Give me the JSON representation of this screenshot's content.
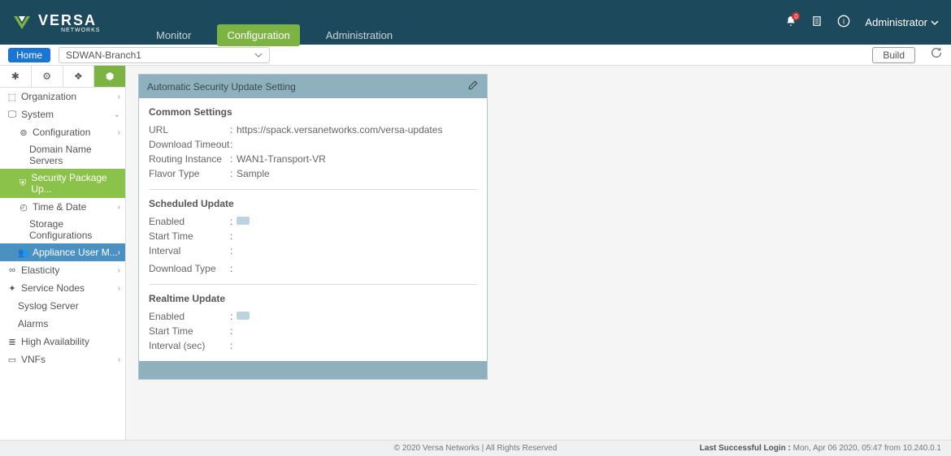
{
  "logo": {
    "text": "VERSA",
    "sub": "NETWORKS"
  },
  "topnav": {
    "monitor": "Monitor",
    "configuration": "Configuration",
    "administration": "Administration"
  },
  "header": {
    "notif_count": "0",
    "admin": "Administrator"
  },
  "subheader": {
    "home": "Home",
    "device": "SDWAN-Branch1",
    "build": "Build"
  },
  "sidebar": {
    "organization": "Organization",
    "system": "System",
    "configuration": "Configuration",
    "dns": "Domain Name Servers",
    "spack": "Security Package Up...",
    "time": "Time & Date",
    "storage": "Storage Configurations",
    "appliance": "Appliance User M...",
    "elasticity": "Elasticity",
    "servicenodes": "Service Nodes",
    "syslog": "Syslog Server",
    "alarms": "Alarms",
    "ha": "High Availability",
    "vnfs": "VNFs"
  },
  "panel": {
    "title": "Automatic Security Update Setting",
    "common": {
      "heading": "Common Settings",
      "url_label": "URL",
      "url_value": "https://spack.versanetworks.com/versa-updates",
      "dtimeout_label": "Download Timeout",
      "dtimeout_value": "",
      "routing_label": "Routing Instance",
      "routing_value": "WAN1-Transport-VR",
      "flavor_label": "Flavor Type",
      "flavor_value": "Sample"
    },
    "scheduled": {
      "heading": "Scheduled Update",
      "enabled_label": "Enabled",
      "start_label": "Start Time",
      "start_value": "",
      "interval_label": "Interval",
      "interval_value": "",
      "dtype_label": "Download Type",
      "dtype_value": ""
    },
    "realtime": {
      "heading": "Realtime Update",
      "enabled_label": "Enabled",
      "start_label": "Start Time",
      "start_value": "",
      "interval_label": "Interval (sec)",
      "interval_value": ""
    }
  },
  "footer": {
    "copyright": "© 2020 Versa Networks | All Rights Reserved",
    "login_label": "Last Successful Login : ",
    "login_value": "Mon, Apr 06 2020, 05:47 from 10.240.0.1"
  }
}
